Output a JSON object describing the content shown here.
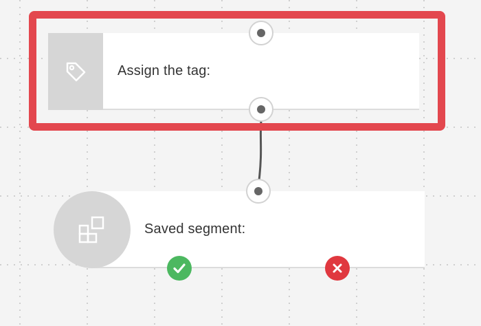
{
  "workflow": {
    "tag_node": {
      "label": "Assign the tag:",
      "icon": "tag-icon",
      "selected": true
    },
    "segment_node": {
      "label": "Saved segment:",
      "icon": "segment-blocks-icon"
    },
    "outcomes": [
      {
        "name": "yes-outcome",
        "icon": "checkmark-icon",
        "color": "#4cb860"
      },
      {
        "name": "no-outcome",
        "icon": "cross-icon",
        "color": "#e0383f"
      }
    ]
  },
  "colors": {
    "selection_border": "#e3474e",
    "canvas": "#f4f4f4",
    "node_icon_bg": "#d6d6d6"
  }
}
